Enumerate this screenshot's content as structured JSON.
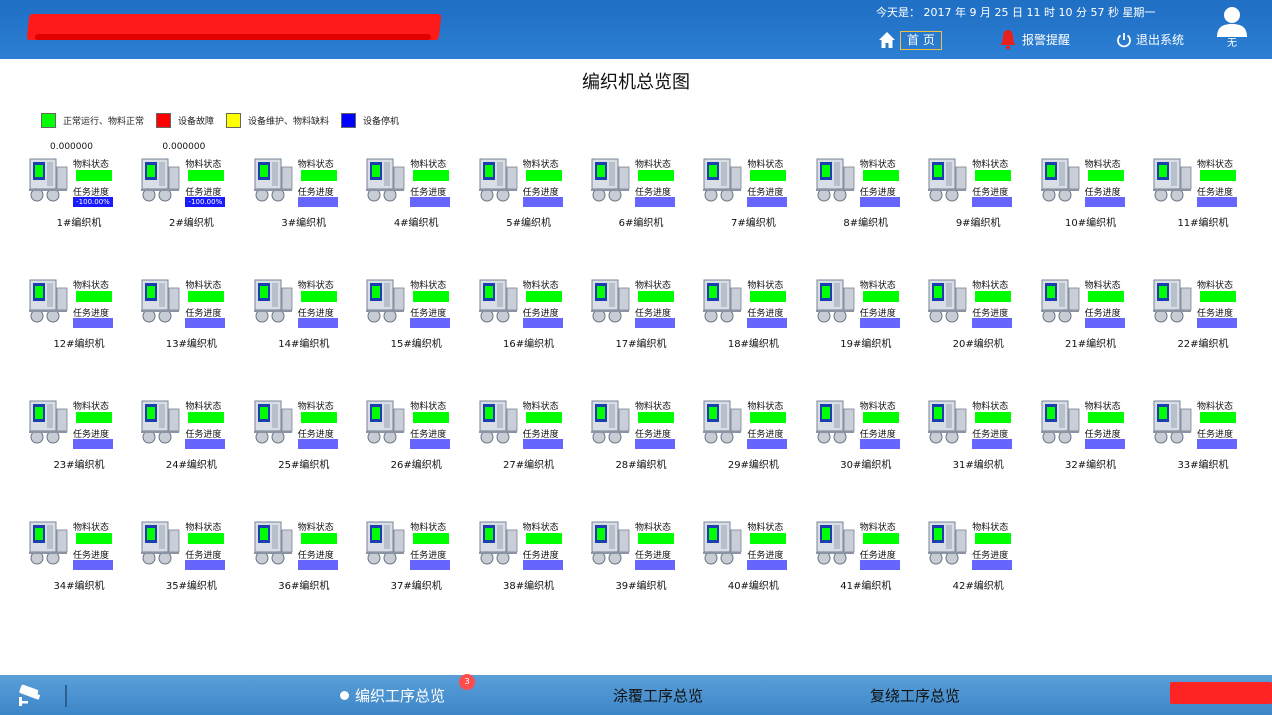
{
  "header": {
    "datetime": "今天是： 2017 年 9 月 25 日  11 时 10 分 57 秒    星期一",
    "home_label": "首 页",
    "alarm_label": "报警提醒",
    "logout_label": "退出系统",
    "user_name": "无"
  },
  "page": {
    "title": "编织机总览图"
  },
  "legend": [
    {
      "label": "正常运行、物料正常",
      "color": "#00ff00"
    },
    {
      "label": "设备故障",
      "color": "#ff0000"
    },
    {
      "label": "设备维护、物料缺料",
      "color": "#ffff00"
    },
    {
      "label": "设备停机",
      "color": "#0000ff"
    }
  ],
  "machine_labels": {
    "material": "物料状态",
    "progress": "任务进度"
  },
  "machines": [
    {
      "name": "1#编织机",
      "value": "0.000000",
      "progress_text": "-100.00%"
    },
    {
      "name": "2#编织机",
      "value": "0.000000",
      "progress_text": "-100.00%"
    },
    {
      "name": "3#编织机"
    },
    {
      "name": "4#编织机"
    },
    {
      "name": "5#编织机"
    },
    {
      "name": "6#编织机"
    },
    {
      "name": "7#编织机"
    },
    {
      "name": "8#编织机"
    },
    {
      "name": "9#编织机"
    },
    {
      "name": "10#编织机"
    },
    {
      "name": "11#编织机"
    },
    {
      "name": "12#编织机"
    },
    {
      "name": "13#编织机"
    },
    {
      "name": "14#编织机"
    },
    {
      "name": "15#编织机"
    },
    {
      "name": "16#编织机"
    },
    {
      "name": "17#编织机"
    },
    {
      "name": "18#编织机"
    },
    {
      "name": "19#编织机"
    },
    {
      "name": "20#编织机"
    },
    {
      "name": "21#编织机"
    },
    {
      "name": "22#编织机"
    },
    {
      "name": "23#编织机"
    },
    {
      "name": "24#编织机"
    },
    {
      "name": "25#编织机"
    },
    {
      "name": "26#编织机"
    },
    {
      "name": "27#编织机"
    },
    {
      "name": "28#编织机"
    },
    {
      "name": "29#编织机"
    },
    {
      "name": "30#编织机"
    },
    {
      "name": "31#编织机"
    },
    {
      "name": "32#编织机"
    },
    {
      "name": "33#编织机"
    },
    {
      "name": "34#编织机"
    },
    {
      "name": "35#编织机"
    },
    {
      "name": "36#编织机"
    },
    {
      "name": "37#编织机"
    },
    {
      "name": "38#编织机"
    },
    {
      "name": "39#编织机"
    },
    {
      "name": "40#编织机"
    },
    {
      "name": "41#编织机"
    },
    {
      "name": "42#编织机"
    }
  ],
  "colors": {
    "material_ok": "#00ff00",
    "progress_bar": "#6666ff",
    "header_bg": "#1f6fc4",
    "footer_bg": "#4a93d0"
  },
  "footer": {
    "tabs": [
      {
        "label": "编织工序总览",
        "active": true
      },
      {
        "label": "涂覆工序总览",
        "active": false
      },
      {
        "label": "复绕工序总览",
        "active": false
      }
    ],
    "badge_count": "3",
    "camera_icon": "camera-icon"
  }
}
